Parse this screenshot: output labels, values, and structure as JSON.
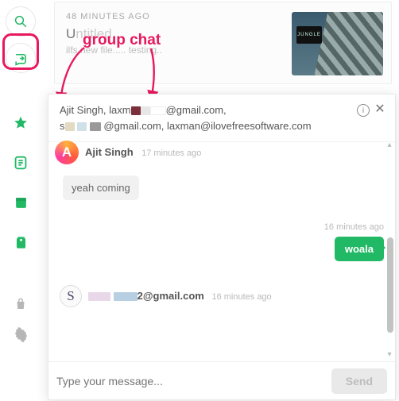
{
  "annotation": {
    "label": "group chat"
  },
  "card": {
    "time": "48 MINUTES AGO",
    "title_prefix": "U",
    "subtitle": "ilfs new file..... testing..",
    "thumb_badge": "JUNGLE"
  },
  "chat": {
    "header_line1_start": "Ajit Singh, laxm",
    "header_line1_end": "@gmail.com,",
    "header_line2_mid": "@gmail.com, laxman@ilovefreesoftware.com",
    "messages": {
      "m1": {
        "name": "Ajit Singh",
        "time": "17 minutes ago",
        "text": "yeah coming"
      },
      "m2": {
        "time": "16 minutes ago",
        "text": "woala"
      },
      "m3": {
        "suffix": "2@gmail.com",
        "time": "16 minutes ago"
      }
    },
    "input_placeholder": "Type your message...",
    "send": "Send"
  }
}
